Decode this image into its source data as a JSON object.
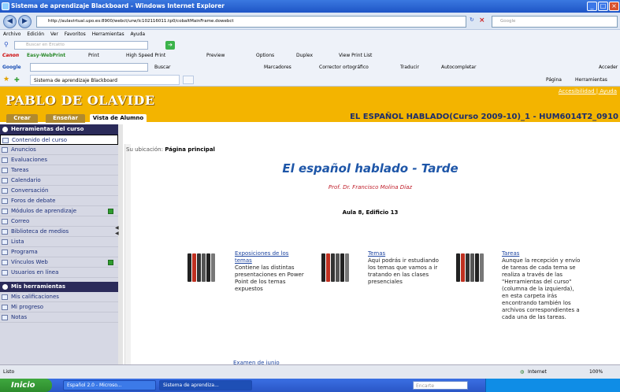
{
  "window": {
    "title": "Sistema de aprendizaje Blackboard - Windows Internet Explorer"
  },
  "address": {
    "url": "http://aulavirtual.upo.es:8900/webct/urw/lc102116011.tp0/cobaltMainFrame.dowebct",
    "search_placeholder": "Google"
  },
  "menu": {
    "items": [
      "Archivo",
      "Edición",
      "Ver",
      "Favoritos",
      "Herramientas",
      "Ayuda"
    ]
  },
  "find": {
    "placeholder": "Buscar en Ercatto"
  },
  "canon": {
    "brand": "Canon",
    "product": "Easy-WebPrint",
    "print": "Print",
    "hs_print": "High Speed Print",
    "preview": "Preview",
    "options": "Options",
    "duplex": "Duplex",
    "view_list": "View Print List"
  },
  "google": {
    "logo": "Google",
    "buscar": "Buscar",
    "marcadores": "Marcadores",
    "corrector": "Corrector ortográfico",
    "traducir": "Traducir",
    "autocompletar": "Autocompletar",
    "acceder": "Acceder"
  },
  "favbar": {
    "tab": "Sistema de aprendizaje Blackboard",
    "pagina": "Página",
    "herramientas": "Herramientas"
  },
  "bb": {
    "logo": "PABLO DE OLAVIDE",
    "toplinks": "Accesibilidad | Ayuda",
    "tabs": [
      "Crear",
      "Enseñar",
      "Vista de Alumno"
    ],
    "course_title": "EL ESPAÑOL HABLADO(Curso 2009-10)_1 - HUM6014T2_0910"
  },
  "sidebar": {
    "head1": "Herramientas del curso",
    "items1": [
      "Contenido del curso",
      "Anuncios",
      "Evaluaciones",
      "Tareas",
      "Calendario",
      "Conversación",
      "Foros de debate",
      "Módulos de aprendizaje",
      "Correo",
      "Biblioteca de medios",
      "Lista",
      "Programa",
      "Vínculos Web",
      "Usuarios en línea"
    ],
    "head2": "Mis herramientas",
    "items2": [
      "Mis calificaciones",
      "Mi progreso",
      "Notas"
    ]
  },
  "content": {
    "crumb_label": "Su ubicación:",
    "crumb_value": "Página principal",
    "title": "El español hablado - Tarde",
    "prof": "Prof. Dr. Francisco Molina Díaz",
    "aula": "Aula 8, Edificio 13",
    "items": [
      {
        "title": "Exposiciones de los temas",
        "desc": "Contiene las distintas presentaciones en Power Point de los temas expuestos"
      },
      {
        "title": "Temas",
        "desc": "Aquí podrás ir estudiando los temas que vamos a ir tratando en las clases presenciales"
      },
      {
        "title": "Tareas",
        "desc": "Aunque la recepción y envío de tareas de cada tema se realiza a través de las \"Herramientas del curso\" (columna de la izquierda), en esta carpeta irás encontrando también los archivos correspondientes a cada una de las tareas."
      }
    ],
    "exam": "Examen de junio"
  },
  "status": {
    "left": "Listo",
    "zone": "Internet",
    "zoom": "100%"
  },
  "taskbar": {
    "start": "Inicio",
    "tasks": [
      "Español 2.0 - Microso...",
      "Sistema de aprendiza..."
    ],
    "search": "Encarte"
  }
}
